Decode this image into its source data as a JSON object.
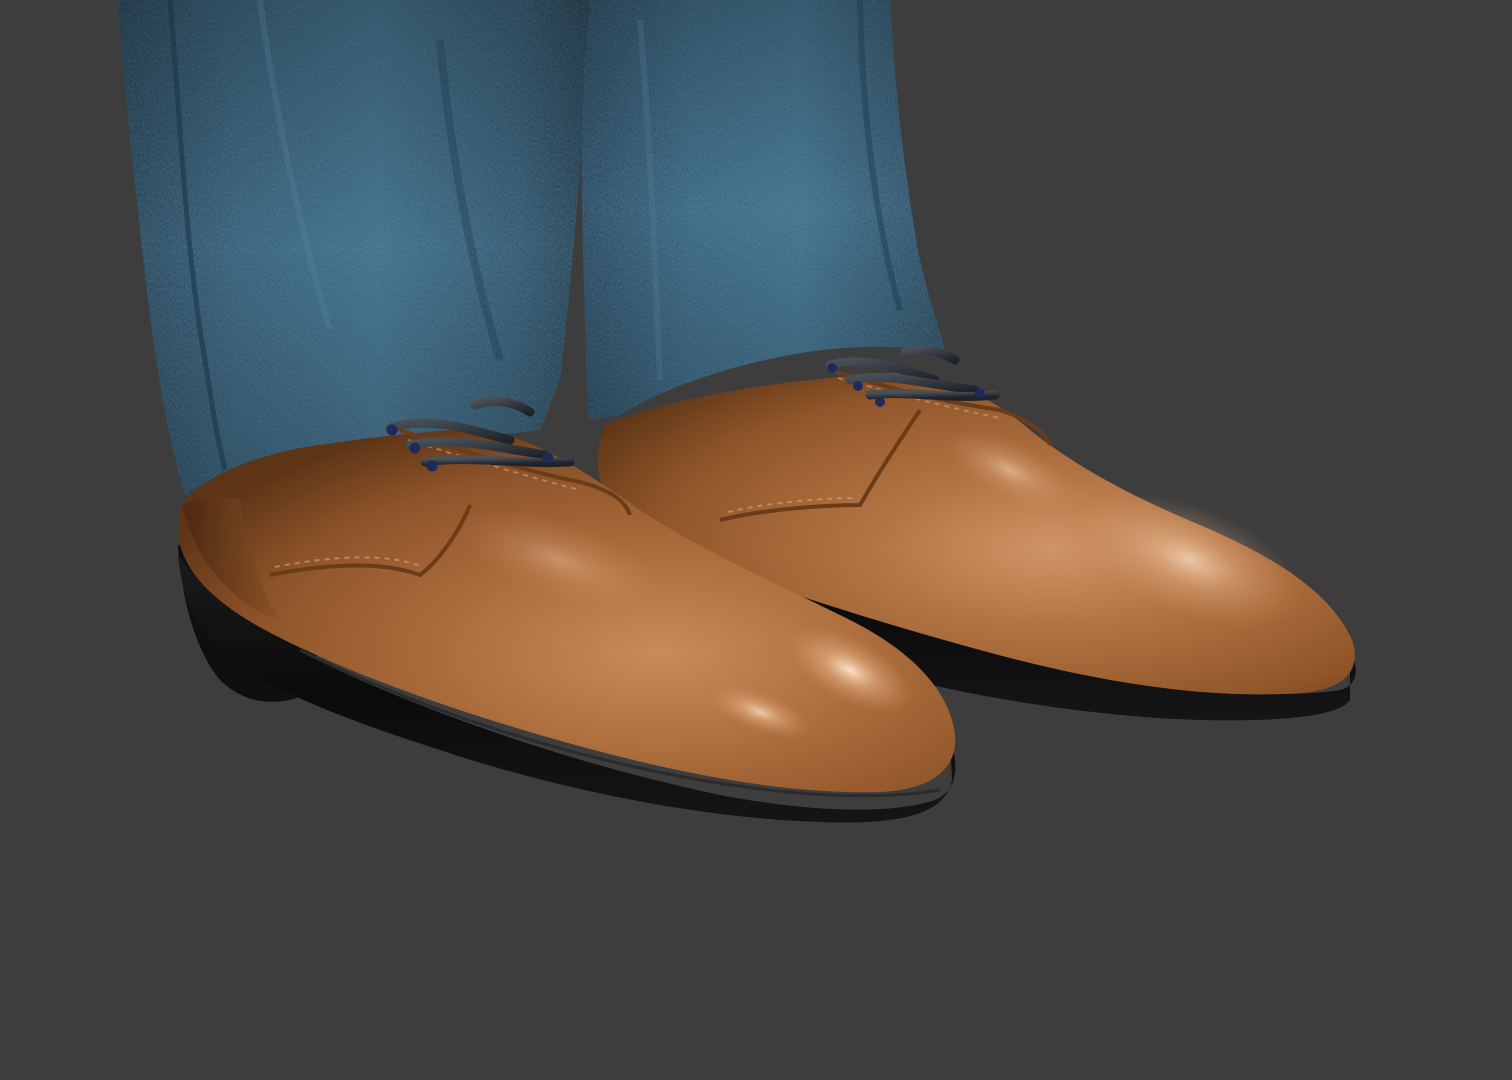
{
  "scene": {
    "subject": "render-of-brown-leather-derby-shoes-with-blue-denim-trousers",
    "colors": {
      "background": "#3d3d3d",
      "denim": "#2f5670",
      "leather": "#a8683a",
      "sole": "#111111",
      "laces": "#2a2e34"
    }
  }
}
